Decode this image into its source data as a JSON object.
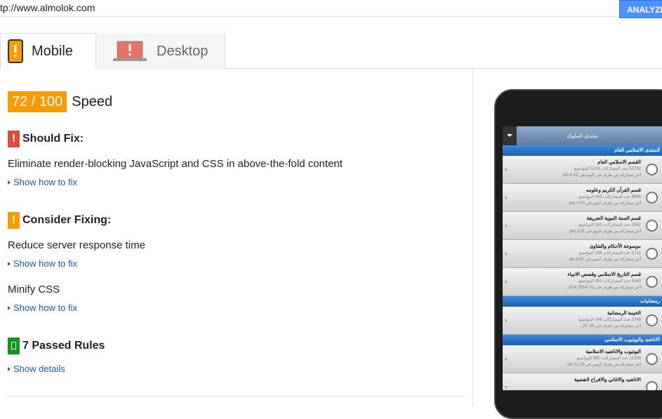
{
  "url_bar": {
    "value": "tp://www.almolok.com",
    "analyze_label": "ANALYZE"
  },
  "tabs": [
    {
      "label": "Mobile",
      "icon": "mobile-phone-warning-icon"
    },
    {
      "label": "Desktop",
      "icon": "laptop-warning-icon"
    }
  ],
  "score": {
    "value": "72 / 100",
    "label": "Speed",
    "color": "#f79b00"
  },
  "should_fix": {
    "title": "Should Fix:",
    "color": "#dd4b39",
    "rules": [
      {
        "text": "Eliminate render-blocking JavaScript and CSS in above-the-fold content",
        "link": "Show how to fix"
      }
    ]
  },
  "consider_fixing": {
    "title": "Consider Fixing:",
    "color": "#f79b00",
    "rules": [
      {
        "text": "Reduce server response time",
        "link": "Show how to fix"
      },
      {
        "text": "Minify CSS",
        "link": "Show how to fix"
      }
    ]
  },
  "passed": {
    "title": "7 Passed Rules",
    "link": "Show details",
    "color": "#109618"
  },
  "preview": {
    "title": "منتدى الملوك",
    "sections": [
      {
        "name": "المنتدى الاسلامي العام",
        "items": [
          {
            "title": "القسم الاسلامي العام",
            "stats": "51702 عدد المشاركات 5243 المواضيع",
            "last": "آخر مشاركة من طرف في اليوم في 5:12 pm"
          },
          {
            "title": "قسم القرآن الكريم وعلومه",
            "stats": "6946 عدد المشاركات 433 المواضيع",
            "last": "آخر مشاركة من طرف اليوم في 1:00 pm"
          },
          {
            "title": "قسم السنة النبوية الشريفة",
            "stats": "2942 عدد المشاركات 161 المواضيع",
            "last": "آخر مشاركة من طرف اليوم في 3:11 pm"
          },
          {
            "title": "موسوعة الأحكام والفتاوى",
            "stats": "3721 عدد المشاركات 236 المواضيع",
            "last": "آخر مشاركة من طرف أمس في 8:07 am"
          },
          {
            "title": "قسم التاريخ الاسلامي وقصص الانبياء",
            "stats": "5443 عدد المشاركات 452 المواضيع",
            "last": "آخر مشاركة من طرف في 01. 2014 10:4..."
          }
        ]
      },
      {
        "name": "رمضانيات",
        "items": [
          {
            "title": "الخيمة الرمضانية",
            "stats": "2748 عدد المشاركات 248 المواضيع",
            "last": "آخر مشاركة من طرف في 05. 20..."
          }
        ]
      },
      {
        "name": "الاناشيد واليوتيوب الاسلامي",
        "items": [
          {
            "title": "اليوتيوب والاناشيد الاسلامية",
            "stats": "11259 عدد المشاركات 950 المواضيع",
            "last": "آخر مشاركة من طرف أمس في 11:15 am"
          },
          {
            "title": "الاناشيد والاغاني والافراح الشعبية",
            "stats": "",
            "last": ""
          }
        ]
      }
    ]
  }
}
